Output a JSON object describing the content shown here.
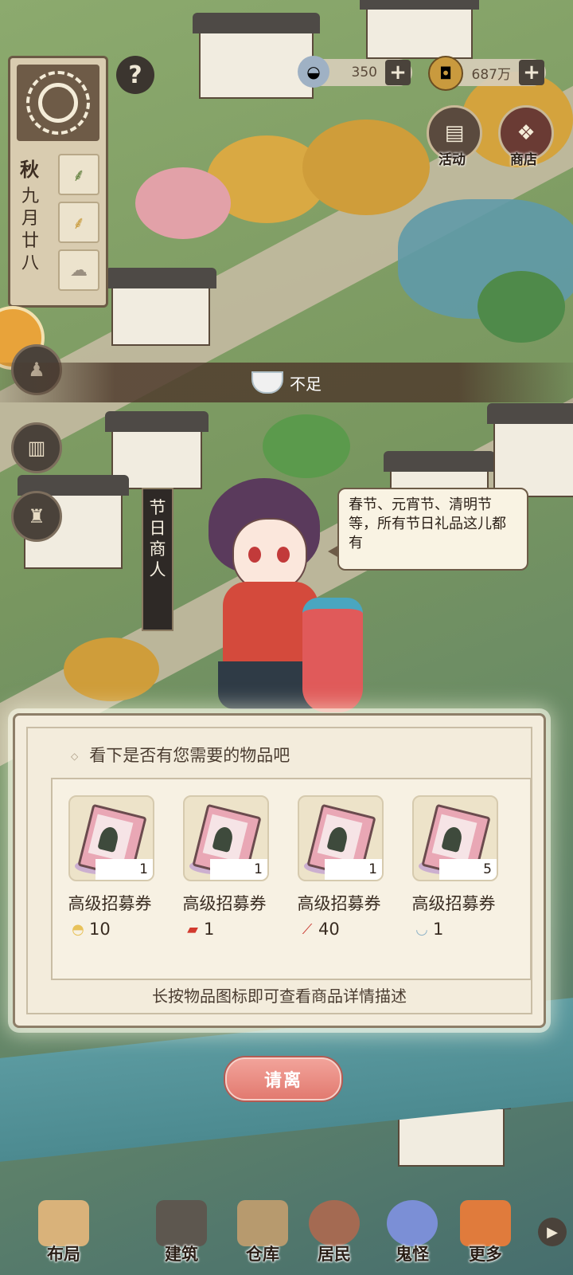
{
  "calendar": {
    "season": "秋",
    "date": "九月廿八",
    "icons": [
      "sun-icon",
      "sprout-icon",
      "wheat-icon",
      "cloud-icon"
    ]
  },
  "currency": {
    "ingot": {
      "amount": "350",
      "icon": "silver-ingot-icon"
    },
    "coin": {
      "amount": "687万",
      "icon": "copper-coin-icon"
    }
  },
  "top_buttons": [
    {
      "label": "活动",
      "icon": "activity-icon"
    },
    {
      "label": "商店",
      "icon": "shop-icon"
    }
  ],
  "status_bar": {
    "text": "不足",
    "icon": "rice-bowl-icon"
  },
  "merchant": {
    "banner": "节日商人",
    "speech": "春节、元宵节、清明节等，所有节日礼品这儿都有"
  },
  "shop": {
    "title": "看下是否有您需要的物品吧",
    "hint": "长按物品图标即可查看商品详情描述",
    "items": [
      {
        "name": "高级招募券",
        "count": "1",
        "price": "10",
        "price_icon": "dumpling-icon",
        "price_color": "#e8c25a"
      },
      {
        "name": "高级招募券",
        "count": "1",
        "price": "1",
        "price_icon": "red-envelope-icon",
        "price_color": "#d23a2e"
      },
      {
        "name": "高级招募券",
        "count": "1",
        "price": "40",
        "price_icon": "firecracker-icon",
        "price_color": "#c8372e"
      },
      {
        "name": "高级招募券",
        "count": "5",
        "price": "1",
        "price_icon": "rice-bowl-icon",
        "price_color": "#8fb3c7"
      }
    ]
  },
  "leave_button": "请离",
  "nav": [
    {
      "label": "布局",
      "icon": "layout-icon"
    },
    {
      "label": "建筑",
      "icon": "building-icon"
    },
    {
      "label": "仓库",
      "icon": "warehouse-icon"
    },
    {
      "label": "居民",
      "icon": "residents-icon"
    },
    {
      "label": "鬼怪",
      "icon": "ghost-icon"
    },
    {
      "label": "更多",
      "icon": "more-icon"
    }
  ],
  "colors": {
    "panel_bg": "#f3ecdc",
    "leave_button": "#e27a70",
    "dark_ui": "#4a423a"
  }
}
